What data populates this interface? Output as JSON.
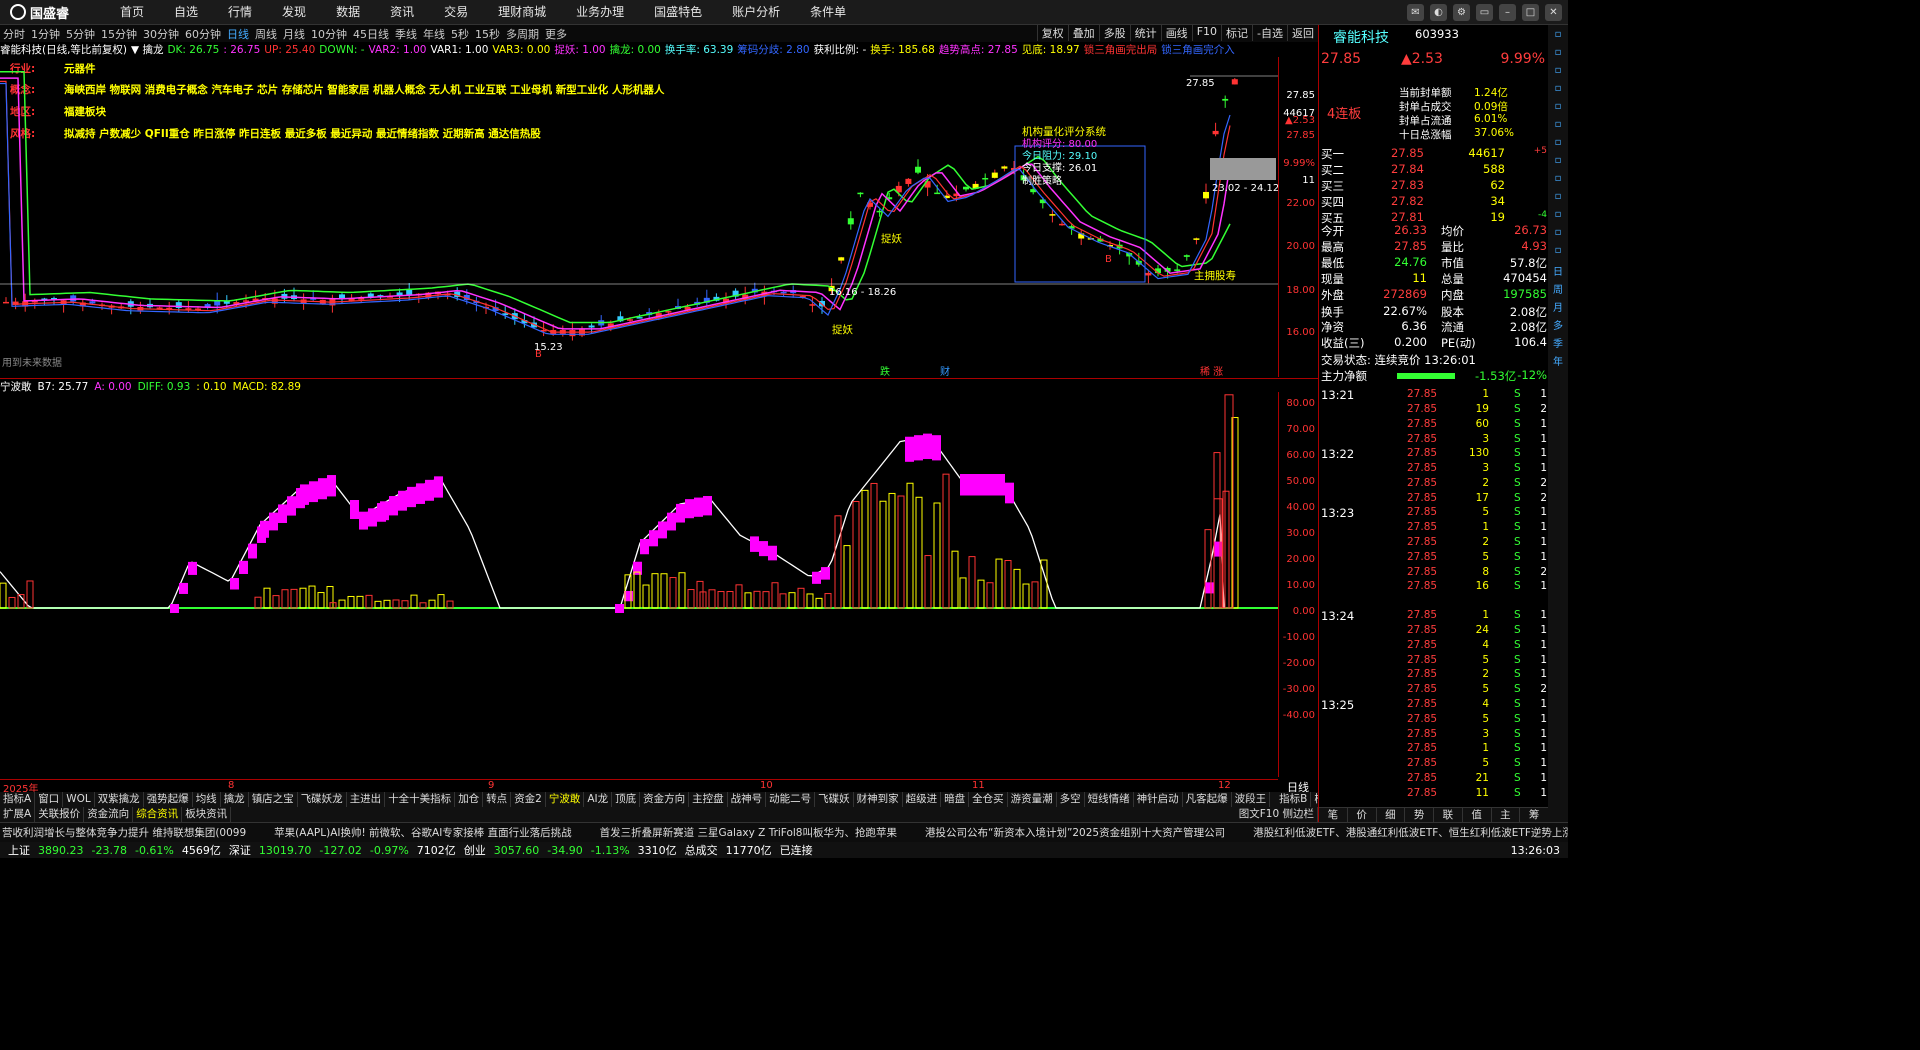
{
  "app": {
    "logo_text": "国盛睿"
  },
  "menu": [
    "首页",
    "自选",
    "行情",
    "发现",
    "数据",
    "资讯",
    "交易",
    "理财商城",
    "业务办理",
    "国盛特色",
    "账户分析",
    "条件单"
  ],
  "periods": [
    "分时",
    "1分钟",
    "5分钟",
    "15分钟",
    "30分钟",
    "60分钟",
    "日线",
    "周线",
    "月线",
    "10分钟",
    "45日线",
    "季线",
    "年线",
    "5秒",
    "15秒",
    "多周期",
    "更多"
  ],
  "active_period": "日线",
  "tools": [
    "复权",
    "叠加",
    "多股",
    "统计",
    "画线",
    "F10",
    "标记",
    "-自选",
    "返回"
  ],
  "indicator_line": [
    {
      "t": "睿能科技(日线,等比前复权)",
      "c": "#fff"
    },
    {
      "t": "▼ 擒龙",
      "c": "#fff"
    },
    {
      "t": "DK: 26.75",
      "c": "#3f3"
    },
    {
      "t": ": 26.75",
      "c": "#f3f"
    },
    {
      "t": "UP: 25.40",
      "c": "#f33"
    },
    {
      "t": "DOWN: -",
      "c": "#3f3"
    },
    {
      "t": "VAR2: 1.00",
      "c": "#f3f"
    },
    {
      "t": "VAR1: 1.00",
      "c": "#fff"
    },
    {
      "t": "VAR3: 0.00",
      "c": "#ff0"
    },
    {
      "t": "捉妖: 1.00",
      "c": "#f3f"
    },
    {
      "t": "擒龙: 0.00",
      "c": "#3f3"
    },
    {
      "t": "换手率: 63.39",
      "c": "#5ff"
    },
    {
      "t": "筹码分歧: 2.80",
      "c": "#36f"
    },
    {
      "t": "获利比例: -",
      "c": "#fff"
    },
    {
      "t": "换手: 185.68",
      "c": "#ff0"
    },
    {
      "t": "趋势高点: 27.85",
      "c": "#f3f"
    },
    {
      "t": "见底: 18.97",
      "c": "#ff0"
    },
    {
      "t": "锁三角画完出局",
      "c": "#f33"
    },
    {
      "t": "锁三角画完介入",
      "c": "#36f"
    }
  ],
  "info": {
    "industry_k": "行业:",
    "industry_v": "元器件",
    "concept_k": "概念:",
    "concept_v": "海峡西岸 物联网 消费电子概念 汽车电子 芯片 存储芯片 智能家居 机器人概念 无人机 工业互联 工业母机 新型工业化 人形机器人",
    "region_k": "地区:",
    "region_v": "福建板块",
    "style_k": "风格:",
    "style_v": "拟减持 户数减少 QFII重仓 昨日涨停 昨日连板 最近多板 最近异动 最近情绪指数 近期新高 通达信热股"
  },
  "chart_labels": {
    "high_tag": "27.85",
    "range1": "23.02 - 24.12",
    "range2": "16.16 - 18.26",
    "low_tag": "15.23",
    "score_title": "机构量化评分系统",
    "score_row1": "机构评分: 80.00",
    "score_row2": "今日阻力: 29.10",
    "score_row3": "今日支撑: 26.01",
    "score_row4": "制胜策略",
    "catch1": "捉妖",
    "catch2": "捉妖",
    "main_tag": "主拥股寿",
    "future": "用到未来数据",
    "b1": "B",
    "b2": "B",
    "tag_s": "S",
    "m1": "跌",
    "m2": "财",
    "m3": "稀 涨"
  },
  "yaxis_main": [
    "27.85",
    "44617",
    "27.85",
    "9.99%",
    "11",
    "22.00",
    "20.00",
    "18.00",
    "16.00"
  ],
  "yaxis_main_top": "▲2.53",
  "sub_head": [
    {
      "t": "宁波敢",
      "c": "#fff"
    },
    {
      "t": "B7: 25.77",
      "c": "#fff"
    },
    {
      "t": "A: 0.00",
      "c": "#f3f"
    },
    {
      "t": "DIFF: 0.93",
      "c": "#3f3"
    },
    {
      "t": ": 0.10",
      "c": "#ff0"
    },
    {
      "t": "MACD: 82.89",
      "c": "#ff0"
    }
  ],
  "yaxis_sub": [
    "80.00",
    "70.00",
    "60.00",
    "50.00",
    "40.00",
    "30.00",
    "20.00",
    "10.00",
    "0.00",
    "-10.00",
    "-20.00",
    "-30.00",
    "-40.00"
  ],
  "xaxis": [
    "2025年",
    "8",
    "9",
    "10",
    "11",
    "12"
  ],
  "xaxis_right": "日线",
  "ind_tabs": [
    "指标A",
    "窗口",
    "WOL",
    "双紫擒龙",
    "强势起爆",
    "均线",
    "擒龙",
    "镇店之宝",
    "飞碟妖龙",
    "主进出",
    "十全十美指标",
    "加仓",
    "转点",
    "资金2",
    "宁波敢",
    "AI龙",
    "顶底",
    "资金方向",
    "主控盘",
    "战神号",
    "动能二号",
    "飞碟妖",
    "财神到家",
    "超级进",
    "暗盘",
    "全仓买",
    "游资量潮",
    "多空",
    "短线情绪",
    "神针启动",
    "凡客起爆",
    "波段王"
  ],
  "ind_tabs_right": [
    "指标B",
    "模板"
  ],
  "active_ind": "宁波敢",
  "bottom_tabs": [
    "扩展A",
    "关联报价",
    "资金流向",
    "综合资讯",
    "板块资讯"
  ],
  "active_bottom": "综合资讯",
  "bottom_right": "图文F10 侧边栏",
  "news": [
    "营收利润增长与整体竞争力提升 维持联想集团(0099",
    "苹果(AAPL)AI换帅! 前微软、谷歌AI专家接棒 直面行业落后挑战",
    "首发三折叠屏新赛道 三星Galaxy Z TriFol8叫板华为、抢跑苹果",
    "港投公司公布“新资本入境计划”2025资金组别十大资产管理公司",
    "港股红利低波ETF、港股通红利低波ETF、恒生红利低波ETF逆势上涨,"
  ],
  "status": {
    "sh_k": "上证",
    "sh_v": "3890.23",
    "sh_c": "-23.78",
    "sh_p": "-0.61%",
    "sh_a": "4569亿",
    "sz_k": "深证",
    "sz_v": "13019.70",
    "sz_c": "-127.02",
    "sz_p": "-0.97%",
    "sz_a": "7102亿",
    "cy_k": "创业",
    "cy_v": "3057.60",
    "cy_c": "-34.90",
    "cy_p": "-1.13%",
    "cy_a": "3310亿",
    "total_k": "总成交",
    "total_v": "11770亿",
    "conn": "已连接",
    "time": "13:26:03"
  },
  "quote": {
    "name": "睿能科技",
    "code": "603933",
    "price": "27.85",
    "change": "▲2.53",
    "pct": "9.99%",
    "board": "4连板",
    "seal_k1": "当前封单额",
    "seal_v1": "1.24亿",
    "seal_k2": "封单占成交",
    "seal_v2": "0.09倍",
    "seal_k3": "封单占流通",
    "seal_v3": "6.01%",
    "seal_k4": "十日总涨幅",
    "seal_v4": "37.06%",
    "bids": [
      [
        "买一",
        "27.85",
        "44617",
        "+5"
      ],
      [
        "买二",
        "27.84",
        "588",
        ""
      ],
      [
        "买三",
        "27.83",
        "62",
        ""
      ],
      [
        "买四",
        "27.82",
        "34",
        ""
      ],
      [
        "买五",
        "27.81",
        "19",
        "-4"
      ]
    ],
    "stats": [
      [
        "今开",
        "26.33",
        "均价",
        "26.73"
      ],
      [
        "最高",
        "27.85",
        "量比",
        "4.93"
      ],
      [
        "最低",
        "24.76",
        "市值",
        "57.8亿"
      ],
      [
        "现量",
        "11",
        "总量",
        "470454"
      ],
      [
        "外盘",
        "272869",
        "内盘",
        "197585"
      ],
      [
        "换手",
        "22.67%",
        "股本",
        "2.08亿"
      ],
      [
        "净资",
        "6.36",
        "流通",
        "2.08亿"
      ],
      [
        "收益(三)",
        "0.200",
        "PE(动)",
        "106.4"
      ]
    ],
    "trade_state": "交易状态: 连续竞价 13:26:01",
    "flow_k": "主力净额",
    "flow_v": "-1.53亿",
    "flow_p": "-12%",
    "ticks": [
      [
        "13:21",
        "27.85",
        "1",
        "S",
        "1"
      ],
      [
        "",
        "27.85",
        "19",
        "S",
        "2"
      ],
      [
        "",
        "27.85",
        "60",
        "S",
        "1"
      ],
      [
        "",
        "27.85",
        "3",
        "S",
        "1"
      ],
      [
        "13:22",
        "27.85",
        "130",
        "S",
        "1"
      ],
      [
        "",
        "27.85",
        "3",
        "S",
        "1"
      ],
      [
        "",
        "27.85",
        "2",
        "S",
        "2"
      ],
      [
        "",
        "27.85",
        "17",
        "S",
        "2"
      ],
      [
        "13:23",
        "27.85",
        "5",
        "S",
        "1"
      ],
      [
        "",
        "27.85",
        "1",
        "S",
        "1"
      ],
      [
        "",
        "27.85",
        "2",
        "S",
        "1"
      ],
      [
        "",
        "27.85",
        "5",
        "S",
        "1"
      ],
      [
        "",
        "27.85",
        "8",
        "S",
        "2"
      ],
      [
        "",
        "27.85",
        "16",
        "S",
        "1"
      ],
      [
        "13:24",
        "27.85",
        "1",
        "S",
        "1"
      ],
      [
        "",
        "27.85",
        "24",
        "S",
        "1"
      ],
      [
        "",
        "27.85",
        "4",
        "S",
        "1"
      ],
      [
        "",
        "27.85",
        "5",
        "S",
        "1"
      ],
      [
        "",
        "27.85",
        "2",
        "S",
        "1"
      ],
      [
        "",
        "27.85",
        "5",
        "S",
        "2"
      ],
      [
        "13:25",
        "27.85",
        "4",
        "S",
        "1"
      ],
      [
        "",
        "27.85",
        "5",
        "S",
        "1"
      ],
      [
        "",
        "27.85",
        "3",
        "S",
        "1"
      ],
      [
        "",
        "27.85",
        "1",
        "S",
        "1"
      ],
      [
        "",
        "27.85",
        "5",
        "S",
        "1"
      ],
      [
        "",
        "27.85",
        "21",
        "S",
        "1"
      ],
      [
        "",
        "27.85",
        "11",
        "S",
        "1"
      ]
    ],
    "tabs": [
      "笔",
      "价",
      "细",
      "势",
      "联",
      "值",
      "主",
      "筹"
    ]
  },
  "side_icons": [
    "日",
    "周",
    "月",
    "多",
    "季",
    "年"
  ]
}
